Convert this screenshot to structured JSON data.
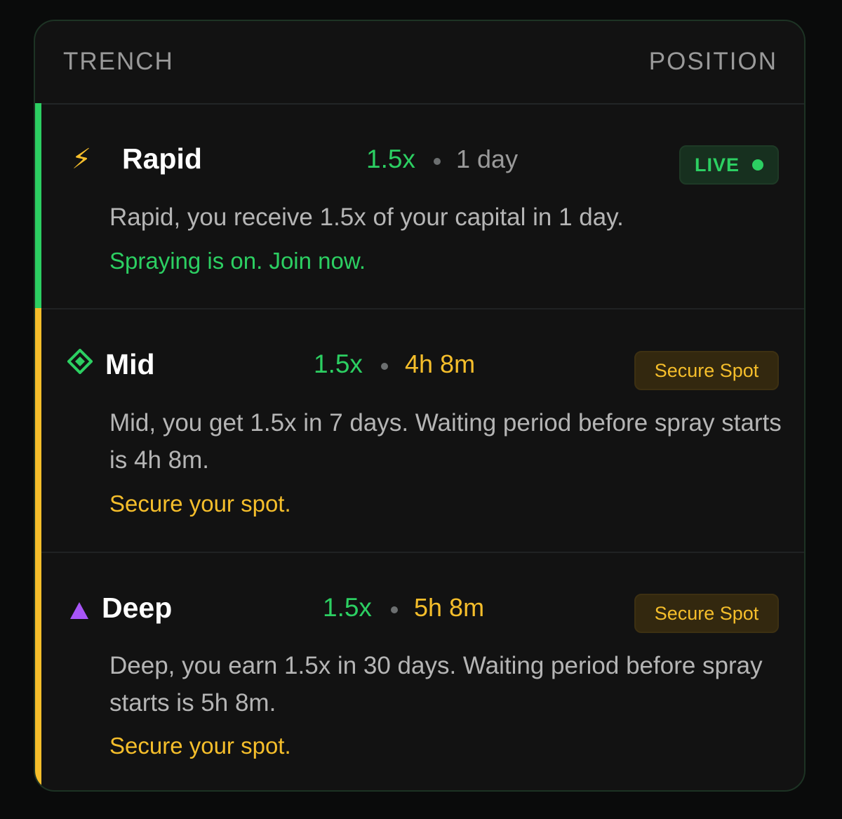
{
  "header": {
    "left_label": "TRENCH",
    "right_label": "POSITION"
  },
  "colors": {
    "green": "#2ccf62",
    "yellow": "#f5be2b",
    "purple": "#a855f7",
    "card_bg": "#121212"
  },
  "trenches": [
    {
      "icon": "lightning-bolt-icon",
      "icon_glyph": "⚡",
      "name": "Rapid",
      "multiplier": "1.5x",
      "duration": "1 day",
      "status": "LIVE",
      "description": "Rapid, you receive 1.5x of your capital in 1 day.",
      "cta": "Spraying is on. Join now.",
      "accent_color": "#2ccf62"
    },
    {
      "icon": "diamond-icon",
      "icon_glyph": "◈",
      "name": "Mid",
      "multiplier": "1.5x",
      "duration": "4h 8m",
      "status": "Secure Spot",
      "description": "Mid, you get 1.5x in 7 days. Waiting period before spray starts is 4h 8m.",
      "cta": "Secure your spot.",
      "accent_color": "#f5be2b"
    },
    {
      "icon": "triangle-icon",
      "icon_glyph": "▲",
      "name": "Deep",
      "multiplier": "1.5x",
      "duration": "5h 8m",
      "status": "Secure Spot",
      "description": "Deep, you earn 1.5x in 30 days. Waiting period before spray starts is 5h 8m.",
      "cta": "Secure your spot.",
      "accent_color": "#f5be2b"
    }
  ]
}
